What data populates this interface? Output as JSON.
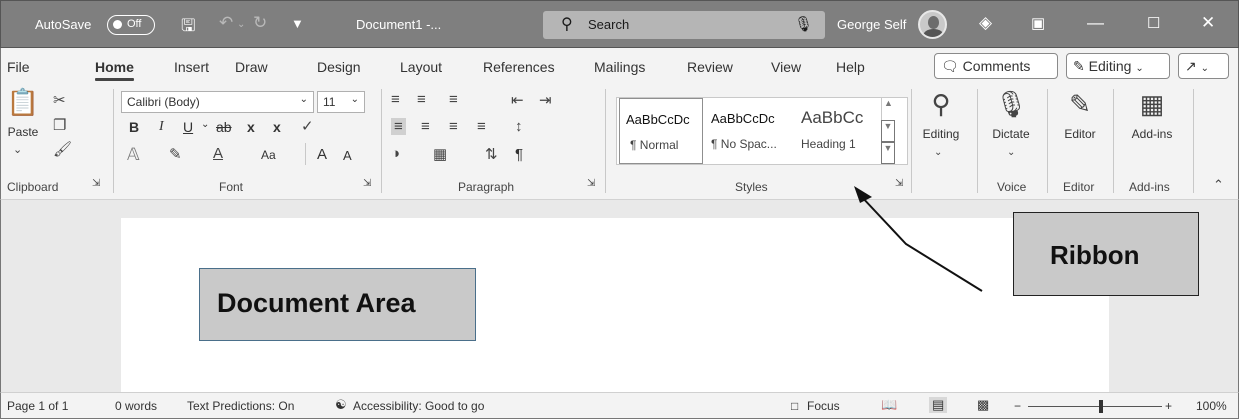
{
  "titlebar": {
    "autosave_label": "AutoSave",
    "autosave_state": "Off",
    "doc_title": "Document1 -...",
    "search_placeholder": "Search",
    "user_name": "George Self",
    "icons": [
      "save-icon",
      "undo-icon",
      "redo-icon",
      "customize-qat-icon",
      "microphone-icon",
      "diamond-icon",
      "ribbon-display-icon",
      "minimize-icon",
      "maximize-icon",
      "close-icon"
    ]
  },
  "menu": {
    "tabs": [
      "File",
      "Home",
      "Insert",
      "Draw",
      "Design",
      "Layout",
      "References",
      "Mailings",
      "Review",
      "View",
      "Help"
    ],
    "active_tab": "Home",
    "comments_label": "Comments",
    "editing_label": "Editing"
  },
  "ribbon": {
    "clipboard": {
      "label": "Clipboard",
      "paste": "Paste"
    },
    "font": {
      "label": "Font",
      "font_name": "Calibri (Body)",
      "font_size": "11",
      "bold": "B",
      "italic": "I",
      "underline": "U",
      "strike": "ab",
      "subscript": "x",
      "superscript": "x",
      "case": "Aa",
      "grow": "A",
      "shrink": "A"
    },
    "paragraph": {
      "label": "Paragraph",
      "pilcrow": "¶"
    },
    "styles": {
      "label": "Styles",
      "items": [
        {
          "sample": "AaBbCcDc",
          "name": "¶ Normal"
        },
        {
          "sample": "AaBbCcDc",
          "name": "¶ No Spac..."
        },
        {
          "sample": "AaBbCc",
          "name": "Heading 1"
        }
      ]
    },
    "editing": {
      "label": "Editing"
    },
    "voice": {
      "label": "Voice",
      "dictate": "Dictate"
    },
    "editor": {
      "label": "Editor",
      "button": "Editor"
    },
    "addins": {
      "label": "Add-ins",
      "button": "Add-ins"
    }
  },
  "annotations": {
    "document_area": "Document Area",
    "ribbon": "Ribbon"
  },
  "statusbar": {
    "page": "Page 1 of 1",
    "words": "0 words",
    "predictions": "Text Predictions: On",
    "accessibility": "Accessibility: Good to go",
    "focus": "Focus",
    "zoom_minus": "−",
    "zoom_plus": "+",
    "zoom": "100%"
  },
  "colors": {
    "titlebar": "#7f7f7f",
    "ribbon_bg": "#f3f3f3",
    "canvas": "#e9e9e9",
    "callout": "#c9c9c9"
  }
}
